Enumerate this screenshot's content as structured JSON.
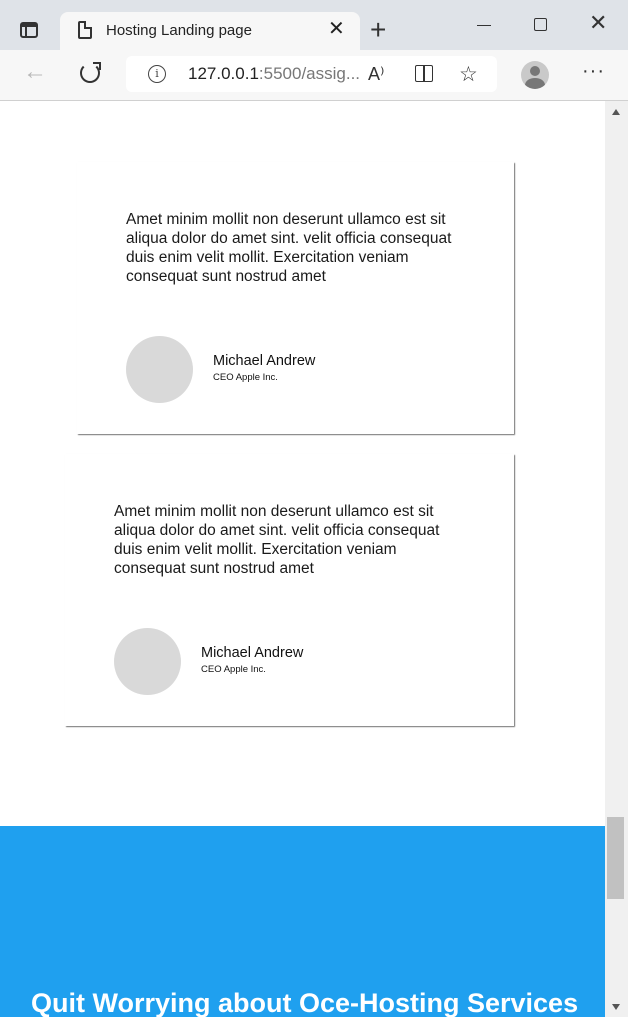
{
  "browser": {
    "tab_title": "Hosting Landing page",
    "tab_close": "✕",
    "new_tab": "+",
    "window_min": "",
    "window_close": "✕",
    "back": "←",
    "info": "i",
    "url_host": "127.0.0.1",
    "url_rest": ":5500/assig...",
    "read_aloud": "A⁾",
    "favorite": "☆",
    "more": "···"
  },
  "testimonials": [
    {
      "quote": "Amet minim mollit non deserunt ullamco est sit aliqua dolor do amet sint. velit officia consequat duis enim velit mollit. Exercitation veniam consequat sunt nostrud amet",
      "name": "Michael Andrew",
      "role": "CEO Apple Inc."
    },
    {
      "quote": "Amet minim mollit non deserunt ullamco est sit aliqua dolor do amet sint. velit officia consequat duis enim velit mollit. Exercitation veniam consequat sunt nostrud amet",
      "name": "Michael Andrew",
      "role": "CEO Apple Inc."
    }
  ],
  "cta": {
    "heading": "Quit Worrying about Oce-Hosting Services"
  },
  "colors": {
    "accent": "#1fa0ef",
    "avatar_placeholder": "#d9d9d9"
  }
}
